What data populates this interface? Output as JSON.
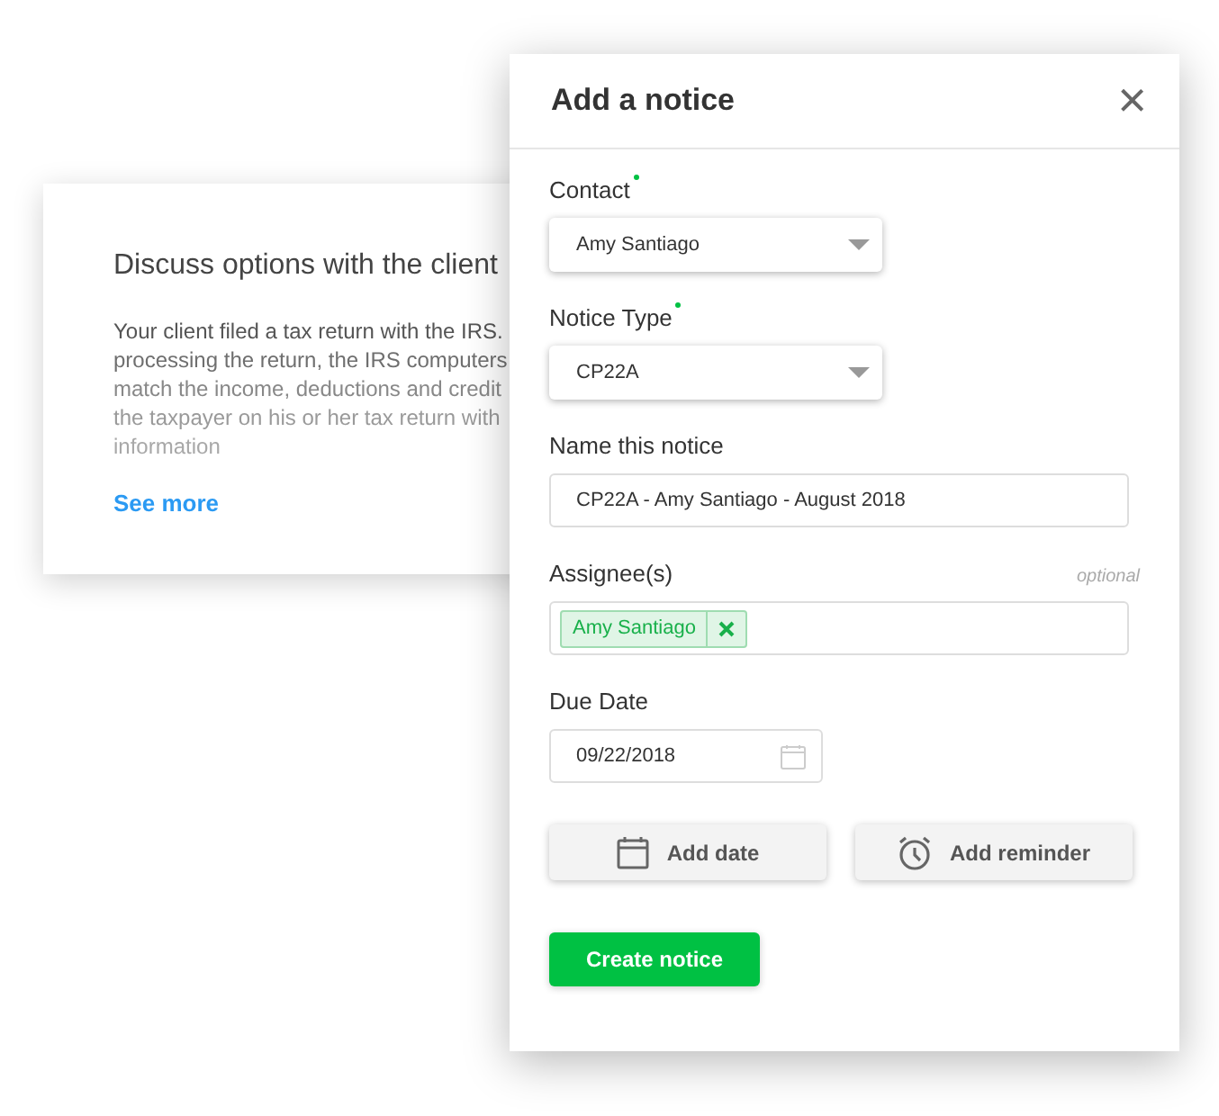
{
  "background_card": {
    "title": "Discuss options with the client",
    "body_lines": [
      "Your client filed a tax return with the IRS.",
      "processing the return, the IRS computers",
      "match the income, deductions and credit",
      "the taxpayer on his or her tax return with",
      "information"
    ],
    "link": "See more"
  },
  "dialog": {
    "title": "Add a notice",
    "close": "×",
    "fields": [
      {
        "kind": "select",
        "label": "Contact",
        "required": true,
        "value": "Amy Santiago"
      },
      {
        "kind": "select",
        "label": "Notice Type",
        "required": true,
        "value": "CP22A"
      },
      {
        "kind": "text",
        "label": "Name this notice",
        "required": false,
        "value": "CP22A - Amy Santiago - August 2018"
      },
      {
        "kind": "tags",
        "label": "Assignee(s)",
        "required": false,
        "hint": "optional",
        "tags": [
          "Amy Santiago"
        ]
      },
      {
        "kind": "date",
        "label": "Due Date",
        "required": false,
        "value": "09/22/2018"
      }
    ],
    "actions": [
      {
        "kind": "calendar",
        "label": "Add date"
      },
      {
        "kind": "alarm",
        "label": "Add reminder"
      }
    ],
    "submit": "Create notice"
  }
}
